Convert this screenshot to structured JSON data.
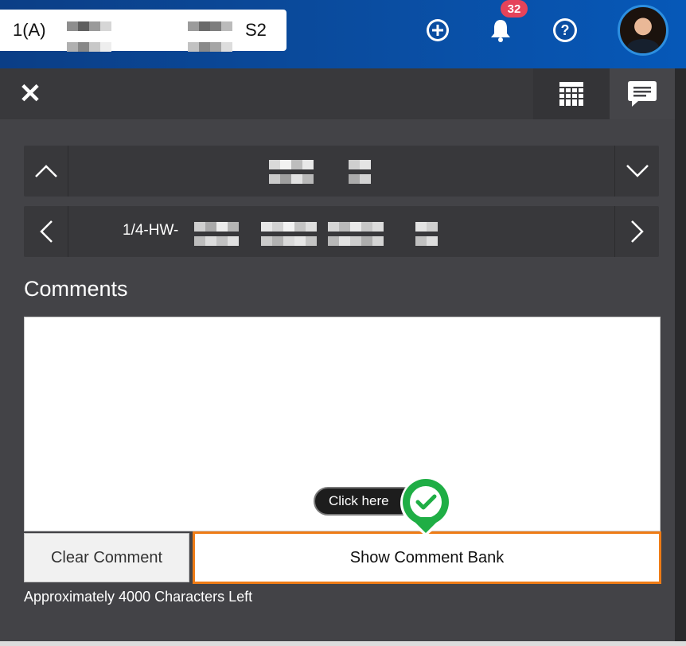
{
  "header": {
    "course_prefix": "1(A)",
    "course_suffix": "S2",
    "notifications_count": "32"
  },
  "panel": {
    "assignment_title": "1/4-HW-",
    "section_title": "Comments",
    "comment_text": "",
    "clear_button": "Clear Comment",
    "show_bank_button": "Show Comment Bank",
    "chars_left": "Approximately 4000 Characters Left"
  },
  "tooltip": {
    "label": "Click here"
  },
  "colors": {
    "topbar": "#0a4da1",
    "panel": "#434347",
    "highlight": "#ef7c16",
    "marker": "#1fae45",
    "badge": "#e5435a"
  },
  "icons": [
    "plus-circle-icon",
    "bell-icon",
    "help-icon",
    "avatar",
    "close-icon",
    "grid-icon",
    "comment-icon",
    "chevron-up-icon",
    "chevron-down-icon",
    "chevron-left-icon",
    "chevron-right-icon",
    "checkmark-icon"
  ]
}
